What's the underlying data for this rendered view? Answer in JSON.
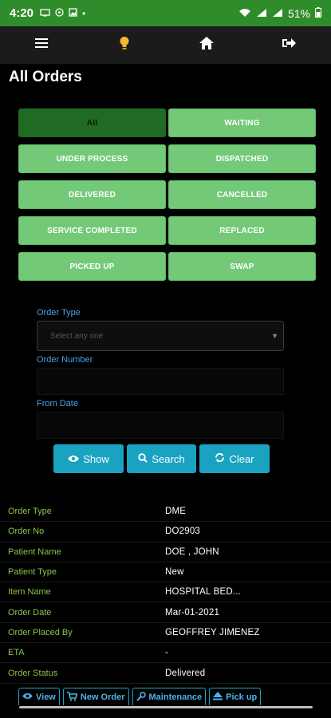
{
  "status": {
    "time": "4:20",
    "battery": "51%"
  },
  "page_title": "All Orders",
  "filters": [
    {
      "label": "All",
      "active": true
    },
    {
      "label": "WAITING"
    },
    {
      "label": "UNDER PROCESS"
    },
    {
      "label": "DISPATCHED"
    },
    {
      "label": "DELIVERED"
    },
    {
      "label": "CANCELLED"
    },
    {
      "label": "SERVICE COMPLETED"
    },
    {
      "label": "REPLACED"
    },
    {
      "label": "PICKED UP"
    },
    {
      "label": "SWAP"
    }
  ],
  "form": {
    "order_type_label": "Order Type",
    "order_type_placeholder": "Select any one",
    "order_number_label": "Order Number",
    "from_date_label": "From Date"
  },
  "actions": {
    "show": "Show",
    "search": "Search",
    "clear": "Clear"
  },
  "details": [
    {
      "label": "Order Type",
      "value": "DME"
    },
    {
      "label": "Order No",
      "value": "DO2903"
    },
    {
      "label": "Patient Name",
      "value": "DOE , JOHN"
    },
    {
      "label": "Patient Type",
      "value": "New"
    },
    {
      "label": "Item Name",
      "value": "HOSPITAL BED..."
    },
    {
      "label": "Order Date",
      "value": "Mar-01-2021"
    },
    {
      "label": "Order Placed By",
      "value": "GEOFFREY JIMENEZ"
    },
    {
      "label": "ETA",
      "value": "-"
    },
    {
      "label": "Order Status",
      "value": "Delivered"
    }
  ],
  "bottom_actions": {
    "view": "View",
    "new_order": "New Order",
    "maintenance": "Maintenance",
    "pickup": "Pick up"
  },
  "colors": {
    "status_bar": "#2f8c2a",
    "filter_button": "#74c978",
    "filter_active": "#1f6b24",
    "action_button": "#1aa3c1",
    "detail_label": "#8bc34a",
    "form_label": "#4aa0e8"
  }
}
